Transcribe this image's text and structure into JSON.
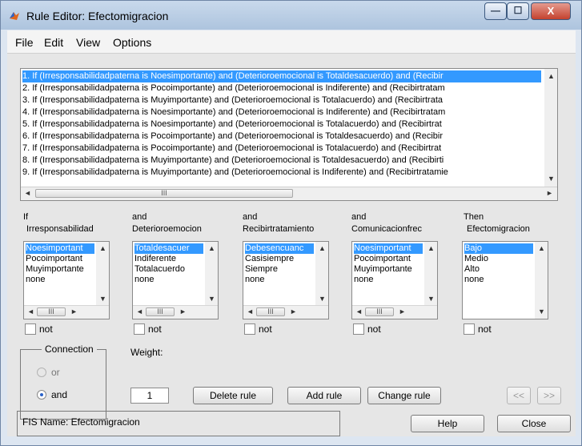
{
  "window": {
    "title": "Rule Editor: Efectomigracion",
    "controls": {
      "minimize": "—",
      "maximize": "☐",
      "close": "X"
    }
  },
  "menu": [
    "File",
    "Edit",
    "View",
    "Options"
  ],
  "rules": [
    "1. If (Irresponsabilidadpaterna is Noesimportante) and (Deterioroemocional is Totaldesacuerdo) and (Recibir",
    "2. If (Irresponsabilidadpaterna is Pocoimportante) and (Deterioroemocional is Indiferente) and (Recibirtratam",
    "3. If (Irresponsabilidadpaterna is Muyimportante) and (Deterioroemocional is Totalacuerdo) and (Recibirtrata",
    "4. If (Irresponsabilidadpaterna is Noesimportante) and (Deterioroemocional is Indiferente) and (Recibirtratam",
    "5. If (Irresponsabilidadpaterna is Noesimportante) and (Deterioroemocional is Totalacuerdo) and (Recibirtrat",
    "6. If (Irresponsabilidadpaterna is Pocoimportante) and (Deterioroemocional is Totaldesacuerdo) and (Recibir",
    "7. If (Irresponsabilidadpaterna is Pocoimportante) and (Deterioroemocional is Totalacuerdo) and (Recibirtrat",
    "8. If (Irresponsabilidadpaterna is Muyimportante) and (Deterioroemocional is Totaldesacuerdo) and (Recibirti",
    "9. If (Irresponsabilidadpaterna is Muyimportante) and (Deterioroemocional is Indiferente) and (Recibirtratamie"
  ],
  "selected_rule": 0,
  "columns": [
    {
      "h1": "If",
      "h2": "Irresponsabilidad",
      "options": [
        "Noesimportant",
        "Pocoimportant",
        "Muyimportante",
        "none"
      ],
      "selected": 0,
      "not_label": "not"
    },
    {
      "h1": "and",
      "h2": "Deterioroemocion",
      "options": [
        "Totaldesacuer",
        "Indiferente",
        "Totalacuerdo",
        "none"
      ],
      "selected": 0,
      "not_label": "not"
    },
    {
      "h1": "and",
      "h2": "Recibirtratamiento",
      "options": [
        "Debesencuanc",
        "Casisiempre",
        "Siempre",
        "none"
      ],
      "selected": 0,
      "not_label": "not"
    },
    {
      "h1": "and",
      "h2": "Comunicacionfrec",
      "options": [
        "Noesimportant",
        "Pocoimportant",
        "Muyimportante",
        "none"
      ],
      "selected": 0,
      "not_label": "not"
    },
    {
      "h1": "Then",
      "h2": "Efectomigracion",
      "options": [
        "Bajo",
        "Medio",
        "Alto",
        "none"
      ],
      "selected": 0,
      "not_label": "not"
    }
  ],
  "connection": {
    "title": "Connection",
    "or_label": "or",
    "and_label": "and",
    "selected": "and"
  },
  "weight": {
    "label": "Weight:",
    "value": "1"
  },
  "buttons": {
    "delete_rule": "Delete rule",
    "add_rule": "Add rule",
    "change_rule": "Change rule",
    "prev": "<<",
    "next": ">>",
    "help": "Help",
    "close": "Close"
  },
  "fis_name": "FIS Name: Efectomigracion",
  "scroll": {
    "h_grip": "III",
    "left_arrow": "◄",
    "right_arrow": "►",
    "up_arrow": "▲",
    "down_arrow": "▼"
  },
  "colors": {
    "selection": "#3399ff",
    "panel": "#e6e6e6"
  }
}
